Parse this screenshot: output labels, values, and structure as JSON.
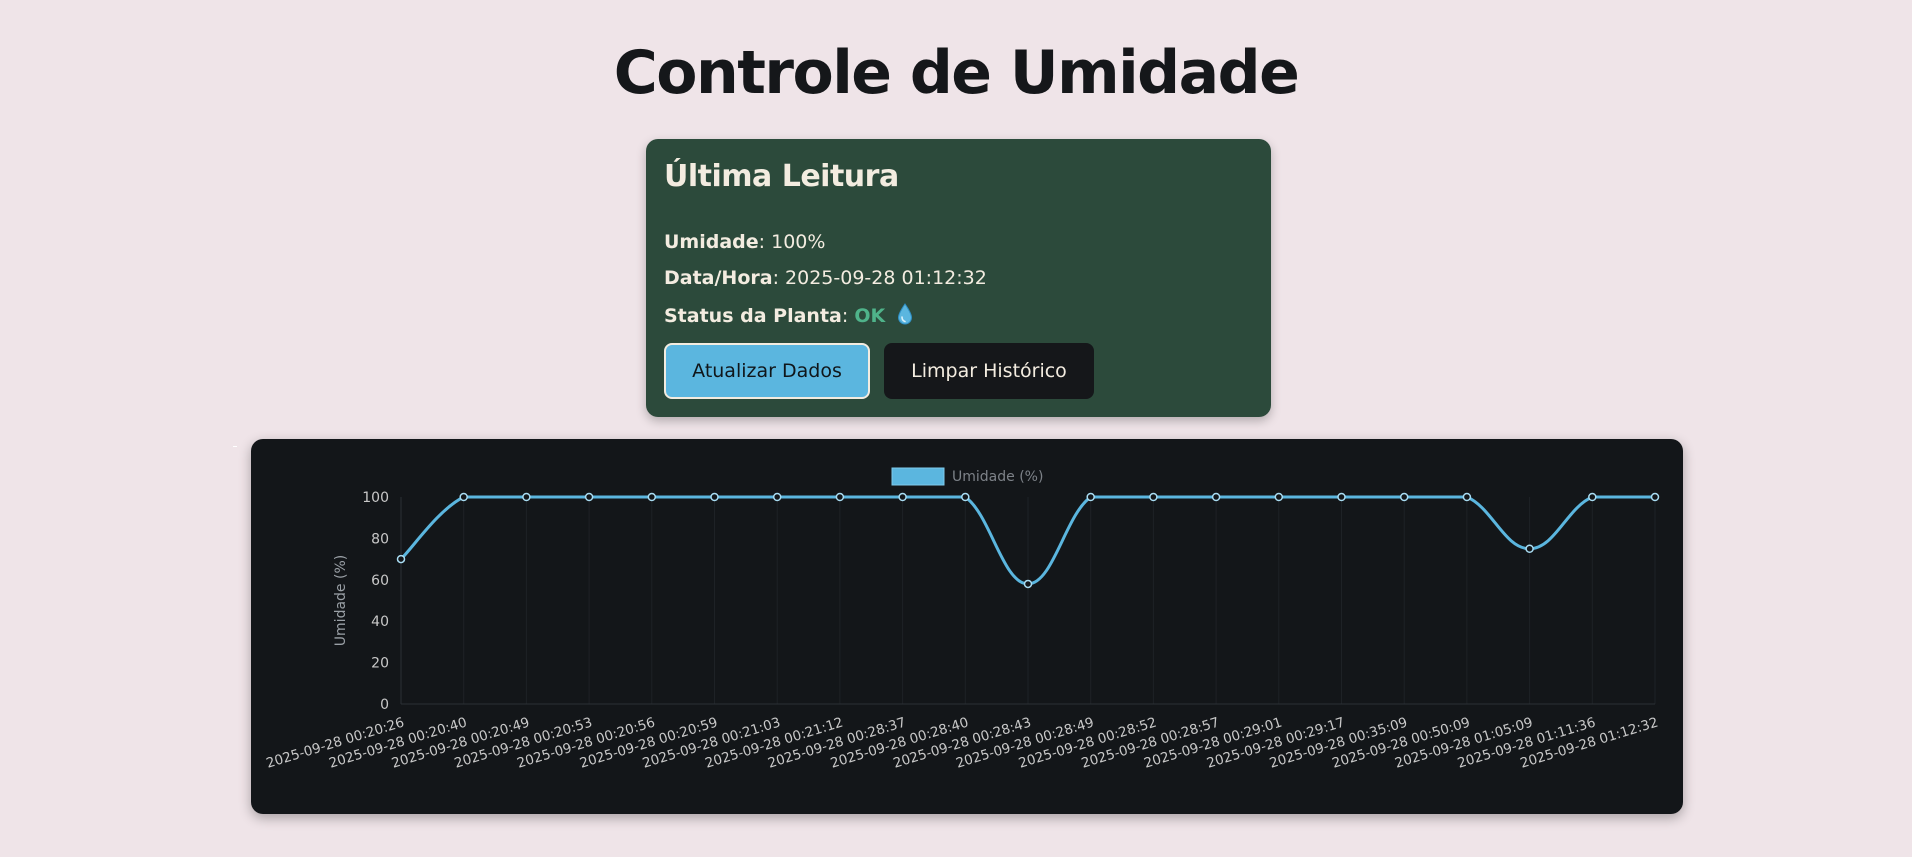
{
  "page": {
    "title": "Controle de Umidade"
  },
  "reading": {
    "title": "Última Leitura",
    "umidade_label": "Umidade",
    "umidade_value": "100%",
    "datahora_label": "Data/Hora",
    "datahora_value": "2025-09-28 01:12:32",
    "status_label": "Status da Planta",
    "status_value": "OK",
    "status_icon": "water-drop-icon",
    "separator": ":"
  },
  "buttons": {
    "update_label": "Atualizar Dados",
    "clear_label": "Limpar Histórico"
  },
  "colors": {
    "background": "#efe4e8",
    "card": "#2c4a3b",
    "status_ok": "#4fb38a",
    "accent": "#5bb6df",
    "chart_bg": "#131619"
  },
  "chart_data": {
    "type": "line",
    "legend": "Umidade (%)",
    "legend_position": "top",
    "ylabel": "Umidade (%)",
    "xlabel": "",
    "ylim": [
      0,
      100
    ],
    "yticks": [
      0,
      20,
      40,
      60,
      80,
      100
    ],
    "grid": true,
    "series": [
      {
        "name": "Umidade (%)",
        "color": "#5bb6df",
        "values": [
          70,
          100,
          100,
          100,
          100,
          100,
          100,
          100,
          100,
          100,
          58,
          100,
          100,
          100,
          100,
          100,
          100,
          100,
          75,
          100,
          100
        ]
      }
    ],
    "categories": [
      "2025-09-28 00:20:26",
      "2025-09-28 00:20:40",
      "2025-09-28 00:20:49",
      "2025-09-28 00:20:53",
      "2025-09-28 00:20:56",
      "2025-09-28 00:20:59",
      "2025-09-28 00:21:03",
      "2025-09-28 00:21:12",
      "2025-09-28 00:28:37",
      "2025-09-28 00:28:40",
      "2025-09-28 00:28:43",
      "2025-09-28 00:28:49",
      "2025-09-28 00:28:52",
      "2025-09-28 00:28:57",
      "2025-09-28 00:29:01",
      "2025-09-28 00:29:17",
      "2025-09-28 00:35:09",
      "2025-09-28 00:50:09",
      "2025-09-28 01:05:09",
      "2025-09-28 01:11:36",
      "2025-09-28 01:12:32"
    ]
  }
}
